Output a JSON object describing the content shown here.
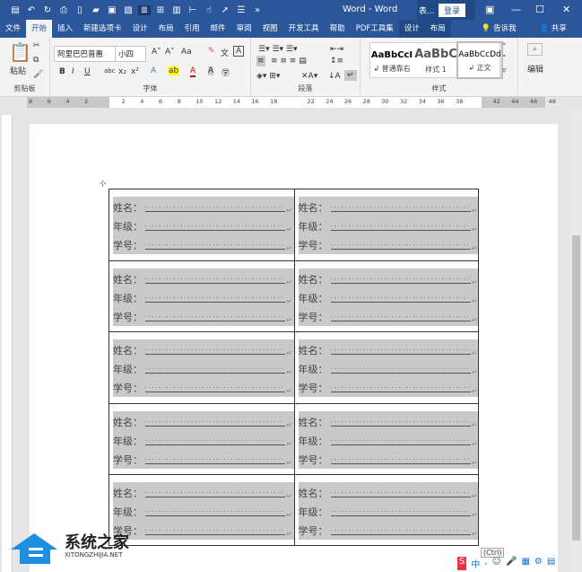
{
  "titlebar": {
    "title": "Word  -  Word",
    "context_label": "表...",
    "login": "登录",
    "quick_access_icons": [
      "save-icon",
      "undo-icon",
      "redo-icon",
      "print-preview-icon",
      "new-doc-icon",
      "open-icon",
      "paste-icon",
      "format-icon",
      "page-icon",
      "table-icon",
      "columns-icon",
      "spacing-icon",
      "touch-icon",
      "select-icon",
      "list-icon",
      "more-icon"
    ]
  },
  "tabs": [
    {
      "label": "文件"
    },
    {
      "label": "开始",
      "active": true
    },
    {
      "label": "插入"
    },
    {
      "label": "新建选项卡"
    },
    {
      "label": "设计"
    },
    {
      "label": "布局"
    },
    {
      "label": "引用"
    },
    {
      "label": "邮件"
    },
    {
      "label": "审阅"
    },
    {
      "label": "视图"
    },
    {
      "label": "开发工具"
    },
    {
      "label": "帮助"
    },
    {
      "label": "PDF工具集"
    },
    {
      "label": "设计",
      "context": true
    },
    {
      "label": "布局",
      "context": true
    }
  ],
  "tell_me": "告诉我",
  "share": "共享",
  "ribbon": {
    "clipboard": {
      "label": "剪贴板",
      "paste": "粘贴"
    },
    "font": {
      "label": "字体",
      "font_name": "阿里巴巴普惠",
      "font_size": "小四",
      "aa": "Aa",
      "bold": "B",
      "italic": "I",
      "underline": "U",
      "strike": "abc",
      "sub": "x₂",
      "sup": "x²"
    },
    "paragraph": {
      "label": "段落"
    },
    "styles": {
      "label": "样式",
      "items": [
        {
          "preview": "AaBbCcI",
          "name": "↲ 普通靠右"
        },
        {
          "preview": "AaBbC",
          "name": "样式 1"
        },
        {
          "preview": "AaBbCcDd",
          "name": "↲ 正文"
        }
      ]
    },
    "editing": {
      "label": "编辑"
    }
  },
  "ruler": {
    "numbers": [
      "8",
      "6",
      "4",
      "2",
      "",
      "2",
      "4",
      "6",
      "8",
      "10",
      "12",
      "14",
      "16",
      "18",
      "",
      "22",
      "24",
      "26",
      "28",
      "30",
      "32",
      "34",
      "36",
      "38",
      "",
      "42",
      "44",
      "46",
      "48"
    ]
  },
  "table": {
    "labels": [
      "姓名：",
      "年级：",
      "学号："
    ],
    "rows": 5,
    "cols": 2
  },
  "paste_options": "(Ctrl)",
  "watermark": {
    "text": "系统之家",
    "url": "XITONGZHIJIA.NET"
  },
  "colors": {
    "brand": "#2b579a",
    "shade": "#c9c9c9"
  }
}
